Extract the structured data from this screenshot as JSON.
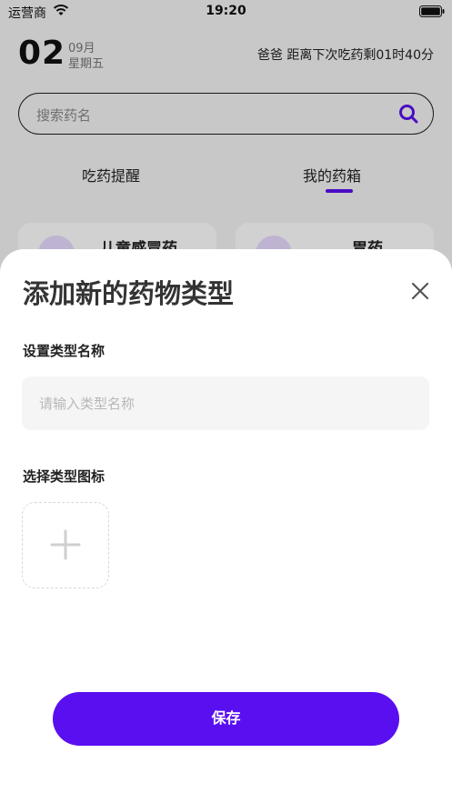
{
  "status_bar": {
    "carrier": "运营商",
    "time": "19:20"
  },
  "header": {
    "day": "02",
    "month": "09月",
    "weekday": "星期五",
    "next_dose": "爸爸 距离下次吃药剩01时40分"
  },
  "search": {
    "placeholder": "搜索药名"
  },
  "tabs": [
    {
      "label": "吃药提醒",
      "active": false
    },
    {
      "label": "我的药箱",
      "active": true
    }
  ],
  "cards": [
    {
      "title": "儿童感冒药"
    },
    {
      "title": "胃药"
    }
  ],
  "modal": {
    "title": "添加新的药物类型",
    "name_label": "设置类型名称",
    "name_placeholder": "请输入类型名称",
    "icon_label": "选择类型图标",
    "save_label": "保存"
  },
  "colors": {
    "accent": "#5a0ff0",
    "input_bg": "#f5f5f5"
  }
}
